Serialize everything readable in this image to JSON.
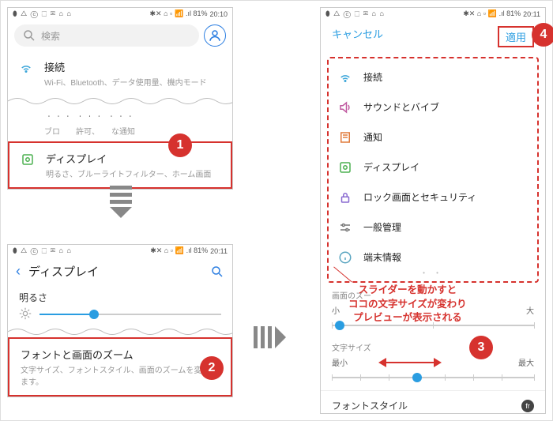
{
  "status": {
    "left": "⬮ △ ⓒ ⬚ ✉ ⌂ ⌂",
    "net": "✱✕ ⌂ ▫",
    "signal": "📶 .ıl 81%",
    "time1": "20:10",
    "time2": "20:11"
  },
  "p1": {
    "search_placeholder": "検索",
    "connect": {
      "title": "接続",
      "sub": "Wi-Fi、Bluetooth、データ使用量、機内モード"
    },
    "partial": {
      "title": "ᆞᆞᆞ ᆞᆞᆞ ᆞᆞᆞ",
      "sub": "ブロ　　許可、　　な通知"
    },
    "display": {
      "title": "ディスプレイ",
      "sub": "明るさ、ブルーライトフィルター、ホーム画面"
    }
  },
  "p2": {
    "title": "ディスプレイ",
    "brightness": "明るさ",
    "fontzoom": {
      "title": "フォントと画面のズーム",
      "sub": "文字サイズ、フォントスタイル、画面のズームを変更します。"
    }
  },
  "p3": {
    "cancel": "キャンセル",
    "apply": "適用",
    "items": [
      "接続",
      "サウンドとバイブ",
      "通知",
      "ディスプレイ",
      "ロック画面とセキュリティ",
      "一般管理",
      "端末情報"
    ],
    "screenzoom": {
      "label": "画面のズー",
      "min": "小",
      "max": "大"
    },
    "fontsize": {
      "label": "文字サイズ",
      "min": "最小",
      "max": "最大"
    },
    "fontstyle": "フォントスタイル"
  },
  "callout": {
    "l1": "スライダーを動かすと",
    "l2": "ココの文字サイズが変わり",
    "l3": "プレビューが表示される"
  },
  "badges": {
    "b1": "1",
    "b2": "2",
    "b3": "3",
    "b4": "4"
  },
  "colors": {
    "accent": "#2a9de1",
    "danger": "#d6322e"
  }
}
